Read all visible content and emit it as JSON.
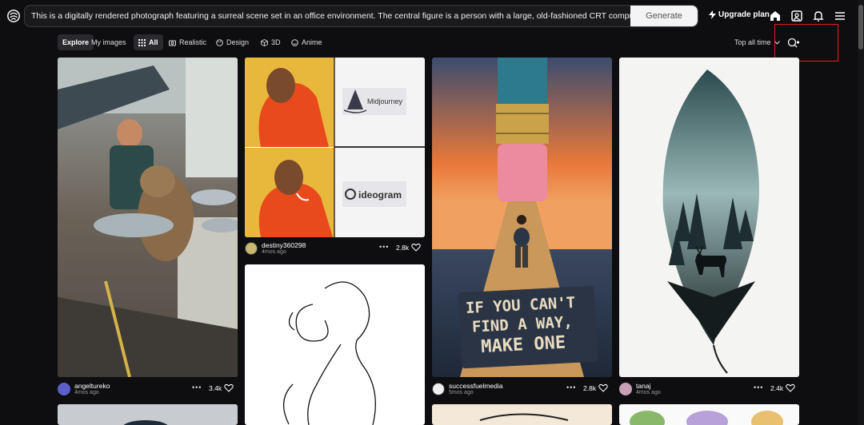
{
  "header": {
    "prompt_text": "This is a digitally rendered photograph featuring a surreal scene set in an office environment. The central figure is a person with a large, old-fashioned CRT computer monitor for a hea",
    "generate_label": "Generate",
    "upgrade_label": "Upgrade plan"
  },
  "filters": {
    "explore": "Explore",
    "my_images": "My images",
    "all": "All",
    "realistic": "Realistic",
    "design": "Design",
    "three_d": "3D",
    "anime": "Anime",
    "time_range": "Top all time"
  },
  "cards": [
    {
      "user": "angeltureko",
      "ago": "4mos ago",
      "likes": "3.4k"
    },
    {
      "user": "destiny360298",
      "ago": "4mos ago",
      "likes": "2.8k",
      "meme_top": "Midjourney",
      "meme_bottom": "ideogram"
    },
    {
      "user": "successfuelmedia",
      "ago": "5mos ago",
      "likes": "2.8k",
      "sign_line1": "IF YOU CAN'T",
      "sign_line2": "FIND A WAY,",
      "sign_line3": "MAKE ONE"
    },
    {
      "user": "tanaj",
      "ago": "4mos ago",
      "likes": "2.4k"
    }
  ],
  "colors": {
    "accent": "#e02020",
    "background": "#0e0e10"
  }
}
